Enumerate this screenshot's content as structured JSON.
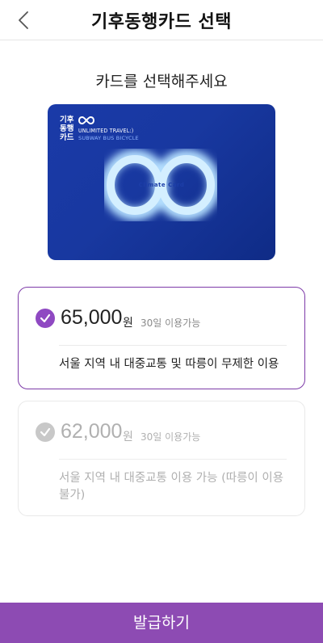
{
  "header": {
    "title": "기후동행카드 선택",
    "back_icon": "chevron-left-icon"
  },
  "subtitle": "카드를 선택해주세요",
  "card": {
    "brand_lines": [
      "기후",
      "동행",
      "카드"
    ],
    "tagline": "UNLIMITED TRAVEL:)",
    "modes": "SUBWAY BUS BICYCLE",
    "center_text": "Climate Card",
    "colors": {
      "background": "#1a3aa8",
      "glow": "#a8d8ff"
    }
  },
  "options": [
    {
      "price": "65,000",
      "unit": "원",
      "period": "30일 이용가능",
      "description": "서울 지역 내 대중교통 및 따릉이 무제한 이용",
      "selected": true
    },
    {
      "price": "62,000",
      "unit": "원",
      "period": "30일 이용가능",
      "description": "서울 지역 내 대중교통 이용 가능 (따릉이 이용 불가)",
      "selected": false
    }
  ],
  "cta": {
    "label": "발급하기"
  },
  "colors": {
    "accent": "#8d4bb3",
    "selected_border": "#7d3aa8",
    "disabled": "#c8c8c8"
  }
}
